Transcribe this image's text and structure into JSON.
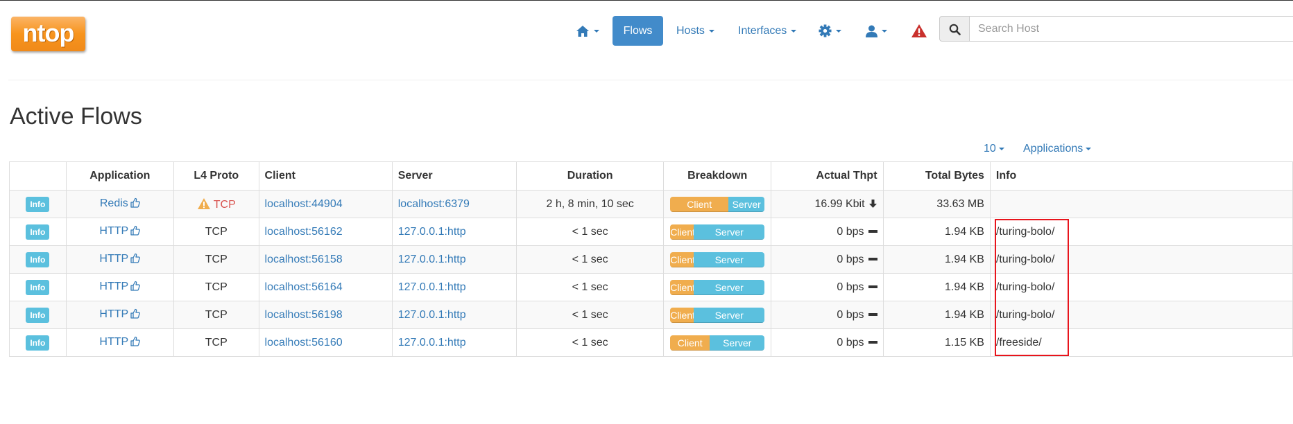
{
  "brand": {
    "logo_text": "ntop",
    "accent": "#f7941d"
  },
  "nav": {
    "home_icon": "home-icon",
    "flows_label": "Flows",
    "hosts_label": "Hosts",
    "interfaces_label": "Interfaces",
    "settings_icon": "gear-icon",
    "user_icon": "user-icon",
    "alert_icon": "warning-icon",
    "search_placeholder": "Search Host"
  },
  "page": {
    "title": "Active Flows"
  },
  "controls": {
    "rows_per_page": "10",
    "applications_label": "Applications"
  },
  "table": {
    "headers": {
      "info": "",
      "application": "Application",
      "l4_proto": "L4 Proto",
      "client": "Client",
      "server": "Server",
      "duration": "Duration",
      "breakdown": "Breakdown",
      "actual_thpt": "Actual Thpt",
      "total_bytes": "Total Bytes",
      "info_col": "Info"
    },
    "info_button_label": "Info",
    "rows": [
      {
        "application": "Redis",
        "l4_proto": "TCP",
        "client_host": "localhost",
        "client_port": ":44904",
        "server_host": "localhost",
        "server_port": ":6379",
        "duration": "2 h, 8 min, 10 sec",
        "breakdown_client": "Client",
        "breakdown_server": "Server",
        "client_share": 0.62,
        "thpt": "16.99 Kbit",
        "total_bytes": "33.63 MB",
        "info": ""
      },
      {
        "application": "HTTP",
        "l4_proto": "TCP",
        "client_host": "localhost",
        "client_port": ":56162",
        "server_host": "127.0.0.1",
        "server_port": ":http",
        "duration": "< 1 sec",
        "breakdown_client": "Client",
        "breakdown_server": "Server",
        "client_share": 0.25,
        "thpt": "0 bps",
        "total_bytes": "1.94 KB",
        "info": "/turing-bolo/"
      },
      {
        "application": "HTTP",
        "l4_proto": "TCP",
        "client_host": "localhost",
        "client_port": ":56158",
        "server_host": "127.0.0.1",
        "server_port": ":http",
        "duration": "< 1 sec",
        "breakdown_client": "Client",
        "breakdown_server": "Server",
        "client_share": 0.25,
        "thpt": "0 bps",
        "total_bytes": "1.94 KB",
        "info": "/turing-bolo/"
      },
      {
        "application": "HTTP",
        "l4_proto": "TCP",
        "client_host": "localhost",
        "client_port": ":56164",
        "server_host": "127.0.0.1",
        "server_port": ":http",
        "duration": "< 1 sec",
        "breakdown_client": "Client",
        "breakdown_server": "Server",
        "client_share": 0.25,
        "thpt": "0 bps",
        "total_bytes": "1.94 KB",
        "info": "/turing-bolo/"
      },
      {
        "application": "HTTP",
        "l4_proto": "TCP",
        "client_host": "localhost",
        "client_port": ":56198",
        "server_host": "127.0.0.1",
        "server_port": ":http",
        "duration": "< 1 sec",
        "breakdown_client": "Client",
        "breakdown_server": "Server",
        "client_share": 0.25,
        "thpt": "0 bps",
        "total_bytes": "1.94 KB",
        "info": "/turing-bolo/"
      },
      {
        "application": "HTTP",
        "l4_proto": "TCP",
        "client_host": "localhost",
        "client_port": ":56160",
        "server_host": "127.0.0.1",
        "server_port": ":http",
        "duration": "< 1 sec",
        "breakdown_client": "Client",
        "breakdown_server": "Server",
        "client_share": 0.42,
        "thpt": "0 bps",
        "total_bytes": "1.15 KB",
        "info": "/freeside/"
      }
    ]
  }
}
